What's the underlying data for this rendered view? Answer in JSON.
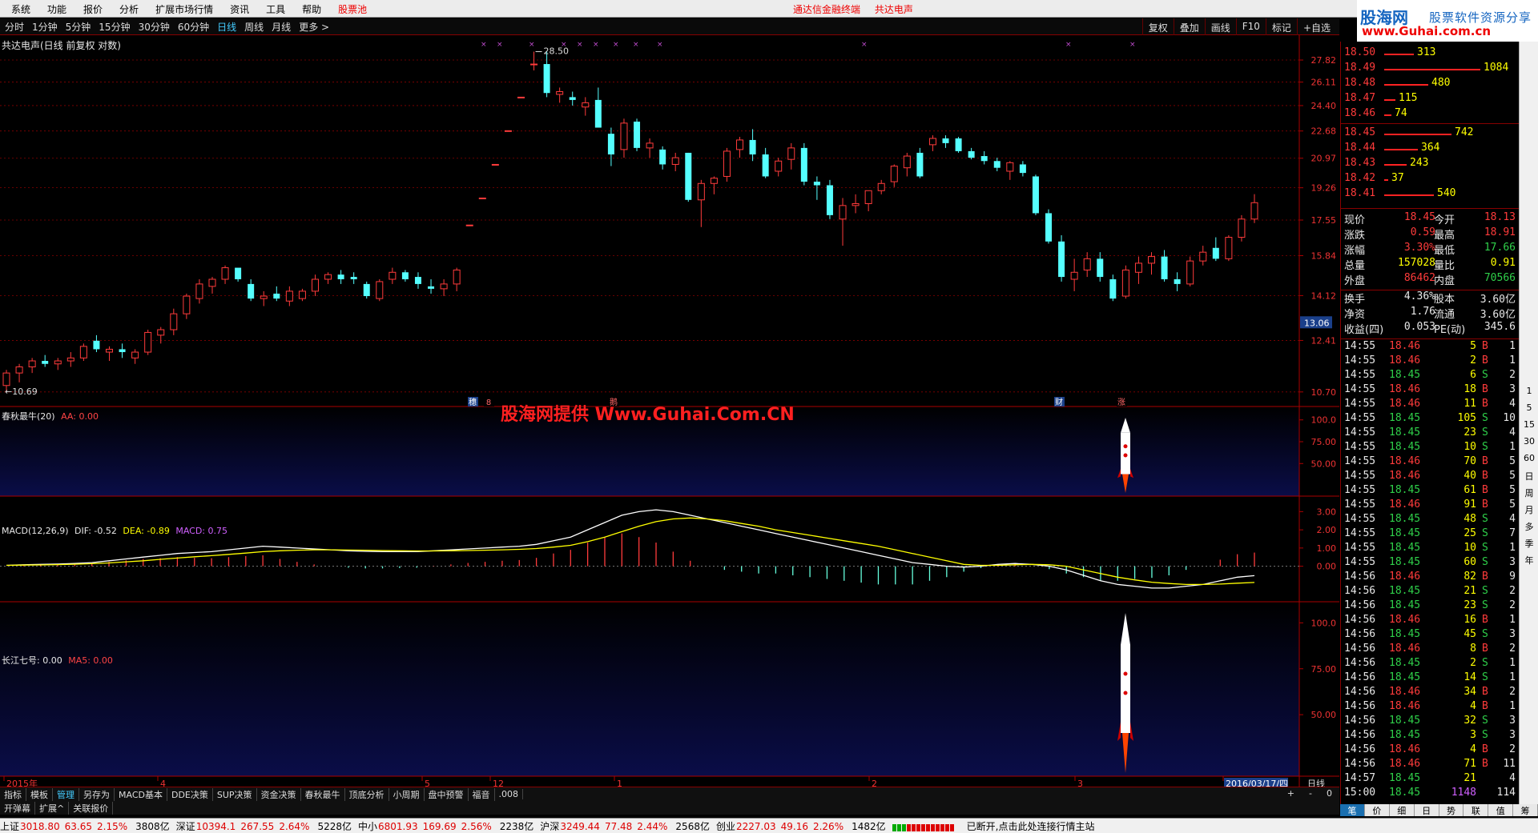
{
  "menu": [
    "系统",
    "功能",
    "报价",
    "分析",
    "扩展市场行情",
    "资讯",
    "工具",
    "帮助",
    "股票池"
  ],
  "top_center": [
    "通达信金融终端",
    "共达电声"
  ],
  "logo": {
    "l1": "股海网",
    "l1b": "股票软件资源分享",
    "l2": "www.Guhai.com.cn"
  },
  "periods": [
    "分时",
    "1分钟",
    "5分钟",
    "15分钟",
    "30分钟",
    "60分钟",
    "日线",
    "周线",
    "月线",
    "更多 >"
  ],
  "active_period": "日线",
  "right_buttons": [
    "复权",
    "叠加",
    "画线",
    "F10",
    "标记",
    "+自选"
  ],
  "stock_title": "共达电声(日线 前复权 对数)",
  "price_axis": [
    "27.82",
    "26.11",
    "24.40",
    "22.68",
    "20.97",
    "19.26",
    "17.55",
    "15.84",
    "14.12",
    "12.41",
    "10.70"
  ],
  "price_high_label": "28.50",
  "price_low_label": "10.69",
  "current_price_tag": "13.06",
  "event_markers": [
    "穗",
    "8",
    "鹅",
    "财",
    "涨"
  ],
  "watermark": "股海网提供 Www.Guhai.Com.CN",
  "ind1": {
    "name": "春秋最牛(20)",
    "sub": "AA: 0.00",
    "axis": [
      "100.0",
      "75.00",
      "50.00"
    ]
  },
  "macd": {
    "name": "MACD(12,26,9)",
    "dif": "DIF: -0.52",
    "dea": "DEA: -0.89",
    "macd": "MACD: 0.75",
    "axis": [
      "3.00",
      "2.00",
      "1.00",
      "0.00"
    ]
  },
  "ind3": {
    "name": "长江七号: 0.00",
    "sub": "MA5: 0.00",
    "axis": [
      "100.0",
      "75.00",
      "50.00"
    ]
  },
  "date_axis": [
    "2015年",
    "4",
    "5",
    "12",
    "1",
    "2",
    "3",
    "2016/03/17/四"
  ],
  "date_period_label": "日线",
  "asks": [
    {
      "p": "18.50",
      "v": "313",
      "w": 37
    },
    {
      "p": "18.49",
      "v": "1084",
      "w": 120
    },
    {
      "p": "18.48",
      "v": "480",
      "w": 55
    },
    {
      "p": "18.47",
      "v": "115",
      "w": 14
    },
    {
      "p": "18.46",
      "v": "74",
      "w": 9
    }
  ],
  "bids": [
    {
      "p": "18.45",
      "v": "742",
      "w": 84
    },
    {
      "p": "18.44",
      "v": "364",
      "w": 42
    },
    {
      "p": "18.43",
      "v": "243",
      "w": 28
    },
    {
      "p": "18.42",
      "v": "37",
      "w": 5
    },
    {
      "p": "18.41",
      "v": "540",
      "w": 62
    }
  ],
  "quote": [
    {
      "l": "现价",
      "v": "18.45",
      "l2": "今开",
      "v2": "18.13",
      "c1": "red",
      "c2": "red"
    },
    {
      "l": "涨跌",
      "v": "0.59",
      "l2": "最高",
      "v2": "18.91",
      "c1": "red",
      "c2": "red"
    },
    {
      "l": "涨幅",
      "v": "3.30%",
      "l2": "最低",
      "v2": "17.66",
      "c1": "red",
      "c2": "grn"
    },
    {
      "l": "总量",
      "v": "157028",
      "l2": "量比",
      "v2": "0.91",
      "c1": "yel",
      "c2": "yel"
    },
    {
      "l": "外盘",
      "v": "86462",
      "l2": "内盘",
      "v2": "70566",
      "c1": "red",
      "c2": "grn"
    },
    {
      "l": "换手",
      "v": "4.36%",
      "l2": "股本",
      "v2": "3.60亿",
      "c1": "wht",
      "c2": "wht"
    },
    {
      "l": "净资",
      "v": "1.76",
      "l2": "流通",
      "v2": "3.60亿",
      "c1": "wht",
      "c2": "wht"
    },
    {
      "l": "收益(四)",
      "v": "0.053",
      "l2": "PE(动)",
      "v2": "345.6",
      "c1": "wht",
      "c2": "wht"
    }
  ],
  "ticks": [
    {
      "t": "14:55",
      "p": "18.46",
      "v": "5",
      "s": "B",
      "n": "1"
    },
    {
      "t": "14:55",
      "p": "18.46",
      "v": "2",
      "s": "B",
      "n": "1"
    },
    {
      "t": "14:55",
      "p": "18.45",
      "v": "6",
      "s": "S",
      "n": "2"
    },
    {
      "t": "14:55",
      "p": "18.46",
      "v": "18",
      "s": "B",
      "n": "3"
    },
    {
      "t": "14:55",
      "p": "18.46",
      "v": "11",
      "s": "B",
      "n": "4"
    },
    {
      "t": "14:55",
      "p": "18.45",
      "v": "105",
      "s": "S",
      "n": "10"
    },
    {
      "t": "14:55",
      "p": "18.45",
      "v": "23",
      "s": "S",
      "n": "4"
    },
    {
      "t": "14:55",
      "p": "18.45",
      "v": "10",
      "s": "S",
      "n": "1"
    },
    {
      "t": "14:55",
      "p": "18.46",
      "v": "70",
      "s": "B",
      "n": "5"
    },
    {
      "t": "14:55",
      "p": "18.46",
      "v": "40",
      "s": "B",
      "n": "5"
    },
    {
      "t": "14:55",
      "p": "18.45",
      "v": "61",
      "s": "B",
      "n": "5"
    },
    {
      "t": "14:55",
      "p": "18.46",
      "v": "91",
      "s": "B",
      "n": "5"
    },
    {
      "t": "14:55",
      "p": "18.45",
      "v": "48",
      "s": "S",
      "n": "4"
    },
    {
      "t": "14:55",
      "p": "18.45",
      "v": "25",
      "s": "S",
      "n": "7"
    },
    {
      "t": "14:55",
      "p": "18.45",
      "v": "10",
      "s": "S",
      "n": "1"
    },
    {
      "t": "14:55",
      "p": "18.45",
      "v": "60",
      "s": "S",
      "n": "3"
    },
    {
      "t": "14:56",
      "p": "18.46",
      "v": "82",
      "s": "B",
      "n": "9"
    },
    {
      "t": "14:56",
      "p": "18.45",
      "v": "21",
      "s": "S",
      "n": "2"
    },
    {
      "t": "14:56",
      "p": "18.45",
      "v": "23",
      "s": "S",
      "n": "2"
    },
    {
      "t": "14:56",
      "p": "18.46",
      "v": "16",
      "s": "B",
      "n": "1"
    },
    {
      "t": "14:56",
      "p": "18.45",
      "v": "45",
      "s": "S",
      "n": "3"
    },
    {
      "t": "14:56",
      "p": "18.46",
      "v": "8",
      "s": "B",
      "n": "2"
    },
    {
      "t": "14:56",
      "p": "18.45",
      "v": "2",
      "s": "S",
      "n": "1"
    },
    {
      "t": "14:56",
      "p": "18.45",
      "v": "14",
      "s": "S",
      "n": "1"
    },
    {
      "t": "14:56",
      "p": "18.46",
      "v": "34",
      "s": "B",
      "n": "2"
    },
    {
      "t": "14:56",
      "p": "18.46",
      "v": "4",
      "s": "B",
      "n": "1"
    },
    {
      "t": "14:56",
      "p": "18.45",
      "v": "32",
      "s": "S",
      "n": "3"
    },
    {
      "t": "14:56",
      "p": "18.45",
      "v": "3",
      "s": "S",
      "n": "3"
    },
    {
      "t": "14:56",
      "p": "18.46",
      "v": "4",
      "s": "B",
      "n": "2"
    },
    {
      "t": "14:56",
      "p": "18.46",
      "v": "71",
      "s": "B",
      "n": "11"
    },
    {
      "t": "14:57",
      "p": "18.45",
      "v": "21",
      "s": "",
      "n": "4"
    },
    {
      "t": "15:00",
      "p": "18.45",
      "v": "1148",
      "s": "",
      "n": "114"
    }
  ],
  "tabs1": [
    "指标",
    "模板",
    "管理",
    "另存为",
    "MACD基本",
    "DDE决策",
    "SUP决策",
    "资金决策",
    "春秋最牛",
    "顶底分析",
    "小周期",
    "盘中预警",
    "福音",
    ".008"
  ],
  "tabs1_active": "管理",
  "tabs2": [
    "开弹幕",
    "扩展^",
    "关联报价"
  ],
  "rbottom_tabs": [
    "笔",
    "价",
    "细",
    "日",
    "势",
    "联",
    "值",
    "筹"
  ],
  "rbottom_active": "笔",
  "zoom_buttons": [
    "+",
    "-",
    "0"
  ],
  "right_strip_labels": [
    "1",
    "5",
    "15",
    "30",
    "60",
    "日",
    "周",
    "月",
    "多",
    "季",
    "年"
  ],
  "status": [
    {
      "n": "上证",
      "v": "3018.80",
      "c": "63.65",
      "p": "2.15%",
      "a": "3808亿"
    },
    {
      "n": "深证",
      "v": "10394.1",
      "c": "267.55",
      "p": "2.64%",
      "a": "5228亿"
    },
    {
      "n": "中小",
      "v": "6801.93",
      "c": "169.69",
      "p": "2.56%",
      "a": "2238亿"
    },
    {
      "n": "沪深",
      "v": "3249.44",
      "c": "77.48",
      "p": "2.44%",
      "a": "2568亿"
    },
    {
      "n": "创业",
      "v": "2227.03",
      "c": "49.16",
      "p": "2.26%",
      "a": "1482亿"
    }
  ],
  "status_msg": "已断开,点击此处连接行情主站",
  "colors": {
    "up": "#ff3b3b",
    "down": "#5ff",
    "grid": "#800",
    "axis": "#a00",
    "bg_ind": "#0a0d48"
  },
  "chart_data": {
    "type": "candlestick",
    "title": "共达电声(日线 前复权 对数)",
    "candles": [
      [
        10.9,
        11.4,
        10.69,
        11.3
      ],
      [
        11.3,
        11.6,
        11.0,
        11.5
      ],
      [
        11.5,
        11.8,
        11.3,
        11.7
      ],
      [
        11.7,
        11.9,
        11.5,
        11.6
      ],
      [
        11.6,
        11.8,
        11.4,
        11.7
      ],
      [
        11.7,
        12.0,
        11.5,
        11.8
      ],
      [
        11.8,
        12.3,
        11.7,
        12.2
      ],
      [
        12.4,
        12.6,
        12.0,
        12.1
      ],
      [
        12.0,
        12.2,
        11.7,
        12.1
      ],
      [
        12.1,
        12.3,
        11.8,
        12.0
      ],
      [
        11.8,
        12.1,
        11.6,
        12.0
      ],
      [
        12.0,
        12.8,
        11.9,
        12.7
      ],
      [
        12.6,
        12.9,
        12.3,
        12.8
      ],
      [
        12.8,
        13.6,
        12.6,
        13.4
      ],
      [
        13.4,
        14.2,
        13.2,
        14.1
      ],
      [
        14.0,
        14.8,
        13.8,
        14.6
      ],
      [
        14.5,
        14.9,
        14.2,
        14.8
      ],
      [
        14.8,
        15.4,
        14.6,
        15.3
      ],
      [
        15.3,
        15.1,
        14.7,
        14.8
      ],
      [
        14.6,
        14.8,
        13.9,
        14.0
      ],
      [
        14.0,
        14.3,
        13.7,
        14.1
      ],
      [
        14.2,
        14.5,
        13.9,
        14.0
      ],
      [
        13.9,
        14.5,
        13.7,
        14.3
      ],
      [
        14.0,
        14.4,
        13.9,
        14.3
      ],
      [
        14.3,
        15.0,
        14.1,
        14.8
      ],
      [
        14.8,
        15.1,
        14.6,
        15.0
      ],
      [
        15.0,
        15.2,
        14.6,
        14.8
      ],
      [
        14.9,
        15.1,
        14.6,
        14.8
      ],
      [
        14.6,
        14.7,
        14.0,
        14.1
      ],
      [
        14.0,
        14.8,
        13.9,
        14.7
      ],
      [
        14.8,
        15.3,
        14.6,
        15.1
      ],
      [
        15.1,
        15.2,
        14.7,
        14.8
      ],
      [
        14.9,
        15.1,
        14.4,
        14.6
      ],
      [
        14.5,
        14.8,
        14.2,
        14.4
      ],
      [
        14.4,
        14.8,
        14.1,
        14.6
      ],
      [
        14.6,
        15.3,
        14.3,
        15.2
      ],
      [
        17.3,
        17.3,
        17.3,
        17.3
      ],
      [
        18.7,
        18.7,
        18.7,
        18.7
      ],
      [
        20.6,
        20.6,
        20.6,
        20.6
      ],
      [
        22.7,
        22.7,
        22.7,
        22.7
      ],
      [
        25.0,
        25.0,
        25.0,
        25.0
      ],
      [
        27.5,
        28.5,
        27.0,
        27.5
      ],
      [
        27.5,
        28.5,
        25.0,
        25.3
      ],
      [
        25.2,
        25.7,
        24.6,
        25.4
      ],
      [
        25.0,
        25.4,
        24.4,
        24.8
      ],
      [
        24.3,
        25.0,
        23.7,
        24.6
      ],
      [
        24.8,
        25.7,
        22.9,
        22.9
      ],
      [
        22.5,
        22.9,
        20.5,
        21.2
      ],
      [
        21.5,
        23.5,
        21.0,
        23.2
      ],
      [
        23.3,
        23.5,
        21.4,
        21.6
      ],
      [
        21.6,
        22.2,
        21.0,
        21.9
      ],
      [
        21.5,
        21.7,
        20.3,
        20.6
      ],
      [
        20.6,
        21.3,
        20.2,
        21.0
      ],
      [
        21.3,
        21.3,
        18.5,
        18.6
      ],
      [
        18.6,
        19.7,
        17.2,
        19.5
      ],
      [
        19.5,
        19.9,
        18.9,
        19.8
      ],
      [
        19.9,
        21.6,
        19.6,
        21.4
      ],
      [
        21.5,
        22.3,
        21.0,
        22.1
      ],
      [
        22.1,
        22.8,
        20.8,
        21.2
      ],
      [
        21.2,
        21.6,
        19.8,
        19.9
      ],
      [
        20.2,
        21.0,
        19.9,
        20.8
      ],
      [
        20.9,
        21.9,
        20.3,
        21.6
      ],
      [
        21.6,
        21.9,
        19.4,
        19.6
      ],
      [
        19.6,
        19.9,
        18.6,
        19.4
      ],
      [
        19.4,
        19.7,
        17.6,
        17.8
      ],
      [
        17.6,
        18.7,
        16.3,
        18.3
      ],
      [
        18.3,
        18.9,
        17.9,
        18.4
      ],
      [
        18.4,
        19.1,
        18.0,
        19.1
      ],
      [
        19.1,
        19.7,
        18.9,
        19.5
      ],
      [
        19.6,
        20.6,
        19.3,
        20.5
      ],
      [
        20.4,
        21.3,
        19.9,
        21.1
      ],
      [
        21.3,
        21.6,
        19.8,
        19.9
      ],
      [
        21.8,
        22.4,
        21.4,
        22.2
      ],
      [
        22.2,
        22.4,
        21.6,
        21.9
      ],
      [
        22.2,
        22.3,
        21.3,
        21.4
      ],
      [
        21.4,
        21.6,
        20.9,
        21.0
      ],
      [
        21.1,
        21.4,
        20.6,
        20.8
      ],
      [
        20.8,
        21.0,
        20.2,
        20.4
      ],
      [
        20.2,
        20.8,
        19.7,
        20.7
      ],
      [
        20.6,
        20.8,
        19.9,
        20.1
      ],
      [
        19.9,
        20.0,
        17.8,
        17.9
      ],
      [
        17.9,
        18.1,
        16.4,
        16.5
      ],
      [
        16.5,
        16.8,
        14.7,
        14.9
      ],
      [
        14.8,
        15.7,
        14.3,
        15.1
      ],
      [
        15.2,
        16.0,
        14.9,
        15.7
      ],
      [
        15.7,
        16.0,
        14.7,
        14.9
      ],
      [
        14.8,
        15.0,
        13.9,
        14.0
      ],
      [
        14.1,
        15.4,
        14.0,
        15.2
      ],
      [
        15.1,
        15.8,
        14.6,
        15.5
      ],
      [
        15.5,
        16.0,
        15.0,
        15.8
      ],
      [
        15.8,
        16.1,
        14.7,
        14.8
      ],
      [
        14.8,
        15.1,
        14.3,
        14.6
      ],
      [
        14.6,
        15.8,
        14.5,
        15.6
      ],
      [
        15.6,
        16.3,
        15.4,
        16.0
      ],
      [
        16.2,
        16.7,
        15.6,
        15.7
      ],
      [
        15.7,
        16.8,
        15.6,
        16.7
      ],
      [
        16.7,
        17.8,
        16.5,
        17.6
      ],
      [
        17.6,
        18.91,
        17.4,
        18.45
      ]
    ],
    "macd": {
      "dif": [
        0.05,
        0.08,
        0.1,
        0.12,
        0.15,
        0.2,
        0.3,
        0.4,
        0.5,
        0.6,
        0.7,
        0.75,
        0.8,
        0.9,
        1.0,
        1.1,
        1.05,
        1.0,
        0.95,
        0.9,
        0.85,
        0.82,
        0.8,
        0.8,
        0.8,
        0.85,
        0.9,
        0.95,
        1.0,
        1.05,
        1.1,
        1.2,
        1.4,
        1.6,
        2.0,
        2.4,
        2.8,
        3.0,
        3.1,
        3.0,
        2.8,
        2.6,
        2.4,
        2.2,
        2.0,
        1.8,
        1.6,
        1.4,
        1.2,
        1.0,
        0.8,
        0.6,
        0.4,
        0.2,
        0.1,
        0.0,
        -0.05,
        0.0,
        0.1,
        0.15,
        0.1,
        0.0,
        -0.2,
        -0.5,
        -0.8,
        -1.0,
        -1.1,
        -1.2,
        -1.2,
        -1.1,
        -1.0,
        -0.8,
        -0.6,
        -0.52
      ],
      "dea": [
        0.05,
        0.06,
        0.07,
        0.09,
        0.11,
        0.14,
        0.18,
        0.24,
        0.3,
        0.38,
        0.45,
        0.52,
        0.58,
        0.65,
        0.72,
        0.8,
        0.85,
        0.88,
        0.9,
        0.9,
        0.89,
        0.88,
        0.86,
        0.85,
        0.84,
        0.84,
        0.85,
        0.86,
        0.88,
        0.9,
        0.93,
        0.97,
        1.05,
        1.15,
        1.35,
        1.6,
        1.9,
        2.2,
        2.45,
        2.6,
        2.65,
        2.6,
        2.5,
        2.35,
        2.2,
        2.0,
        1.85,
        1.7,
        1.55,
        1.4,
        1.25,
        1.1,
        0.9,
        0.7,
        0.5,
        0.3,
        0.1,
        0.05,
        0.05,
        0.08,
        0.1,
        0.08,
        0.0,
        -0.2,
        -0.4,
        -0.6,
        -0.75,
        -0.88,
        -0.95,
        -1.0,
        -1.0,
        -0.98,
        -0.93,
        -0.89
      ],
      "hist": [
        0,
        0.04,
        0.06,
        0.06,
        0.08,
        0.12,
        0.24,
        0.32,
        0.4,
        0.44,
        0.5,
        0.46,
        0.44,
        0.5,
        0.56,
        0.6,
        0.4,
        0.24,
        0.1,
        0,
        -0.08,
        -0.12,
        -0.12,
        -0.1,
        -0.08,
        0.02,
        0.1,
        0.18,
        0.24,
        0.3,
        0.34,
        0.46,
        0.7,
        0.9,
        1.3,
        1.6,
        1.8,
        1.6,
        1.3,
        0.8,
        0.3,
        0,
        -0.2,
        -0.3,
        -0.4,
        -0.4,
        -0.5,
        -0.6,
        -0.7,
        -0.8,
        -0.9,
        -1.0,
        -1.0,
        -1.0,
        -0.8,
        -0.6,
        -0.3,
        -0.1,
        0.1,
        0.14,
        0,
        -0.16,
        -0.4,
        -0.6,
        -0.8,
        -0.8,
        -0.7,
        -0.64,
        -0.5,
        -0.2,
        0,
        0.36,
        0.66,
        0.75
      ],
      "ylim": [
        -1.6,
        3.5
      ]
    }
  }
}
